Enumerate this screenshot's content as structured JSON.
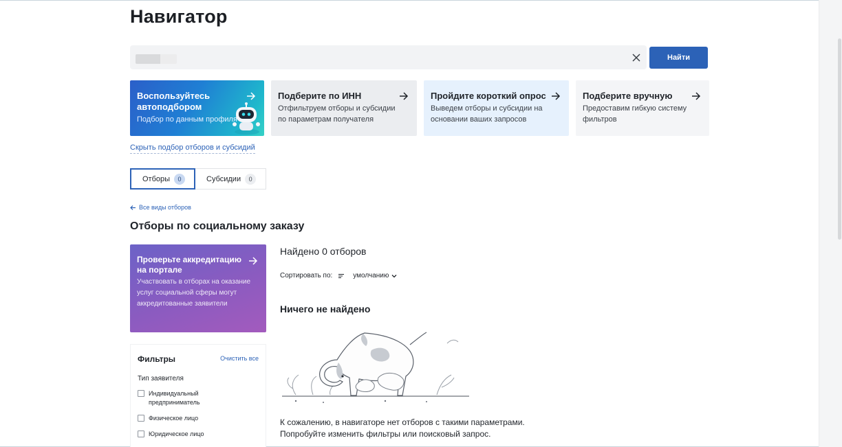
{
  "page": {
    "title": "Навигатор"
  },
  "search": {
    "placeholder": "",
    "value": "",
    "button_label": "Найти"
  },
  "cards": [
    {
      "title": "Воспользуйтесь автоподбором",
      "desc": "Подбор по данным профиля"
    },
    {
      "title": "Подберите по ИНН",
      "desc": "Отфильтруем отборы и субсидии по параметрам получателя"
    },
    {
      "title": "Пройдите короткий опрос",
      "desc": "Выведем отборы и субсидии на основании ваших запросов"
    },
    {
      "title": "Подберите вручную",
      "desc": "Предоставим гибкую систему фильтров"
    }
  ],
  "hide_link": "Скрыть подбор отборов и субсидий",
  "tabs": [
    {
      "label": "Отборы",
      "count": "0"
    },
    {
      "label": "Субсидии",
      "count": "0"
    }
  ],
  "back_link": "Все виды отборов",
  "section_title": "Отборы по социальному заказу",
  "promo": {
    "title": "Проверьте аккредитацию на портале",
    "desc": "Участвовать в отборах на оказание услуг социальной сферы могут аккредитованные заявители"
  },
  "filters": {
    "title": "Фильтры",
    "clear_label": "Очистить все",
    "group_title": "Тип заявителя",
    "options": [
      "Индивидуальный предприниматель",
      "Физическое лицо",
      "Юридическое лицо"
    ]
  },
  "results": {
    "found": "Найдено 0 отборов",
    "sort_label": "Сортировать по:",
    "sort_value": "умолчанию",
    "empty_title": "Ничего не найдено",
    "empty_line1": "К сожалению, в навигаторе нет отборов с такими параметрами.",
    "empty_line2": "Попробуйте изменить фильтры или поисковый запрос."
  },
  "colors": {
    "accent": "#2c62b7",
    "card_auto_start": "#2b5fc9",
    "card_auto_end": "#36d1c6",
    "promo_start": "#6c62c7",
    "promo_end": "#a35bbd"
  },
  "icons": [
    "clear-icon",
    "arrow-right-icon",
    "robot-icon",
    "arrow-left-icon",
    "sort-icon",
    "chevron-down-icon",
    "dog-illustration"
  ]
}
